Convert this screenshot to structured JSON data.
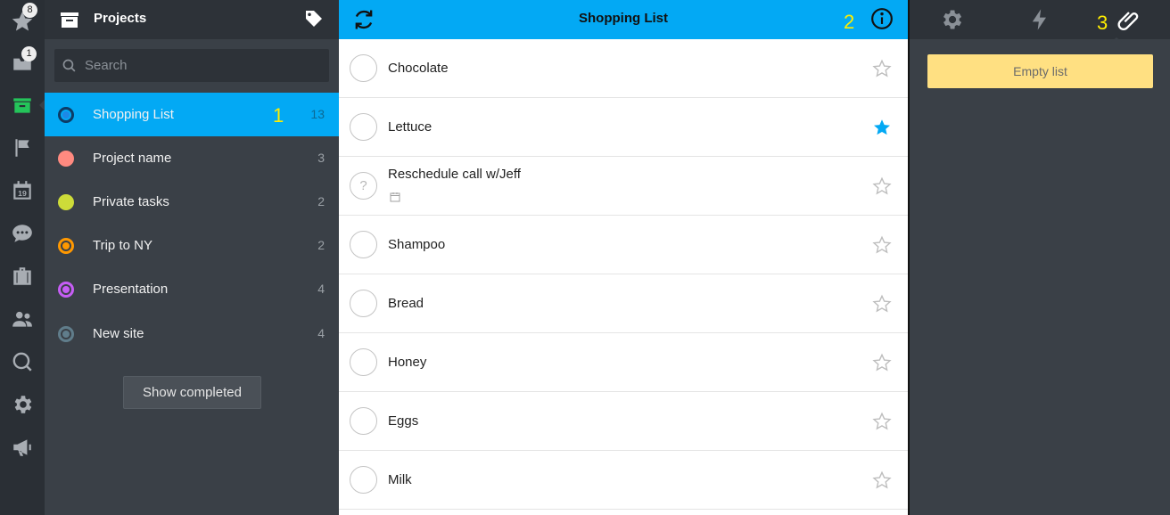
{
  "rail": {
    "starred_badge": "8",
    "inbox_badge": "1"
  },
  "projects": {
    "title": "Projects",
    "search_placeholder": "Search",
    "items": [
      {
        "name": "Shopping List",
        "count": "13",
        "color": "#1e88e5",
        "marker": "1"
      },
      {
        "name": "Project name",
        "count": "3",
        "color": "#ff8a80"
      },
      {
        "name": "Private tasks",
        "count": "2",
        "color": "#cddc39"
      },
      {
        "name": "Trip to NY",
        "count": "2",
        "color": "#ff9800"
      },
      {
        "name": "Presentation",
        "count": "4",
        "color": "#c65df5"
      },
      {
        "name": "New site",
        "count": "4",
        "color": "#607d8b"
      }
    ],
    "show_completed": "Show completed"
  },
  "tasks": {
    "title": "Shopping List",
    "marker": "2",
    "items": [
      {
        "name": "Chocolate",
        "starred": false
      },
      {
        "name": "Lettuce",
        "starred": true
      },
      {
        "name": "Reschedule call w/Jeff",
        "starred": false,
        "has_date": true
      },
      {
        "name": "Shampoo",
        "starred": false
      },
      {
        "name": "Bread",
        "starred": false
      },
      {
        "name": "Honey",
        "starred": false
      },
      {
        "name": "Eggs",
        "starred": false
      },
      {
        "name": "Milk",
        "starred": false
      }
    ]
  },
  "details": {
    "marker": "3",
    "empty_list": "Empty list",
    "active_tab": "attachments"
  },
  "colors": {
    "accent": "#03a9f4",
    "active_rail": "#24c45a",
    "marker": "#ffee00",
    "star_active": "#03a9f4"
  }
}
